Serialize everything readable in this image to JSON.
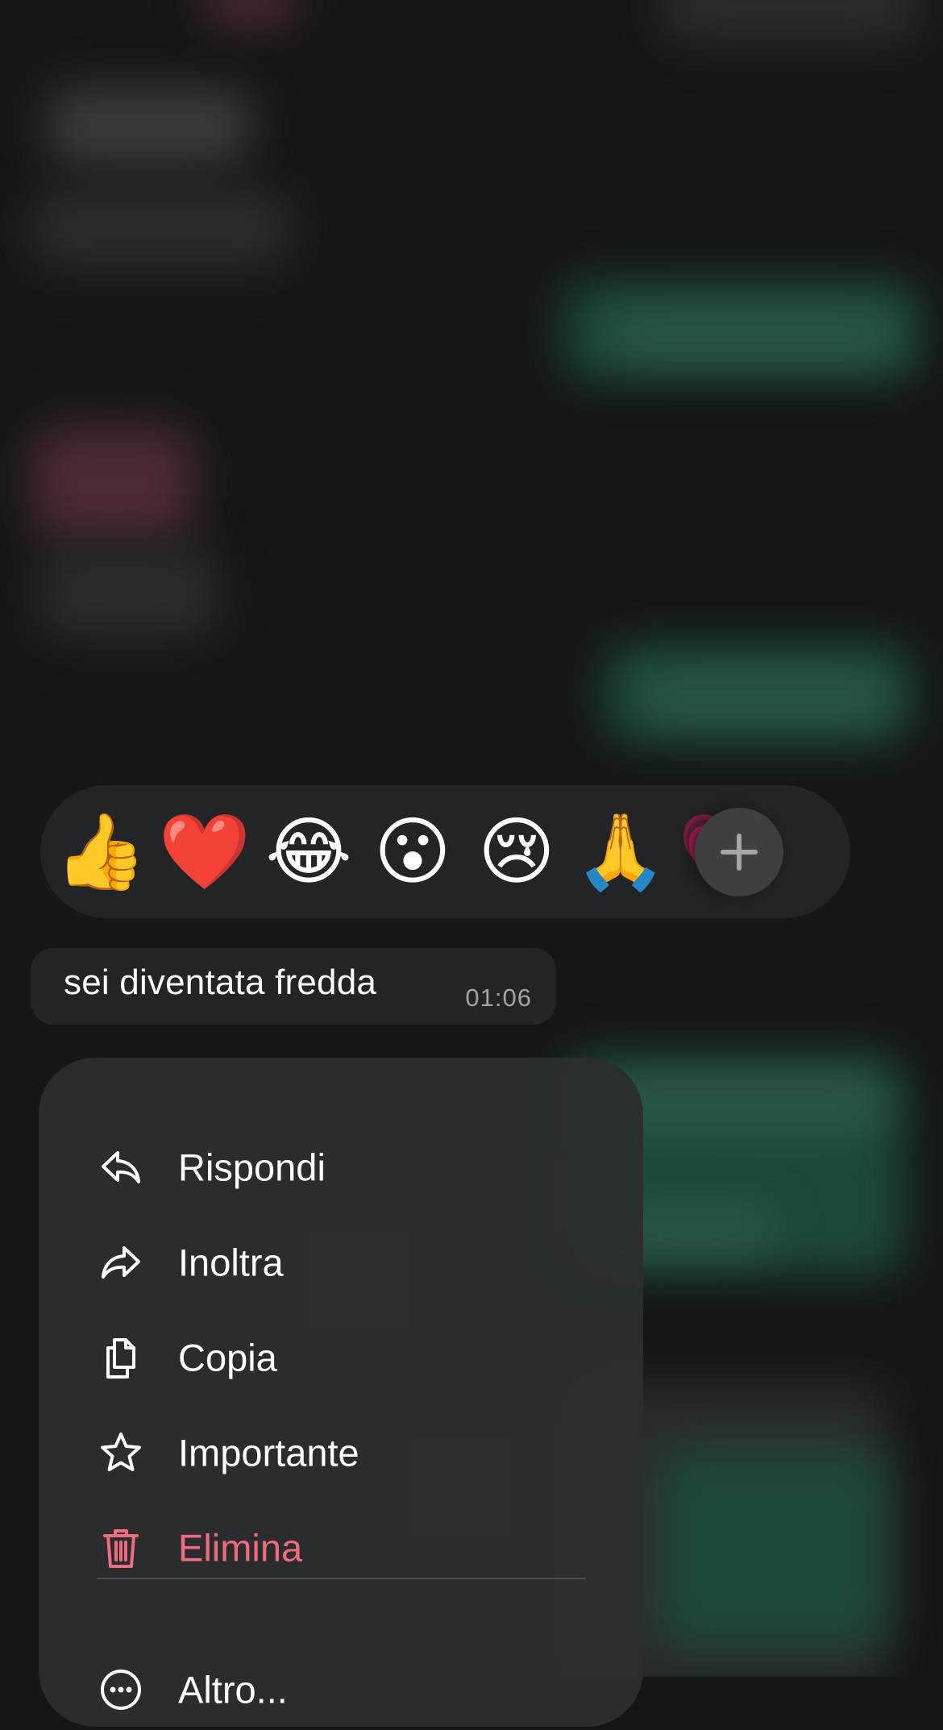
{
  "reactions": {
    "emojis": [
      "👍",
      "❤️",
      "😂",
      "😮",
      "😢",
      "🙏",
      "💗"
    ],
    "more_icon": "plus-icon"
  },
  "message": {
    "text": "sei diventata fredda",
    "time": "01:06"
  },
  "menu": {
    "items": [
      {
        "label": "Rispondi",
        "icon": "reply-icon"
      },
      {
        "label": "Inoltra",
        "icon": "forward-icon"
      },
      {
        "label": "Copia",
        "icon": "copy-icon"
      },
      {
        "label": "Importante",
        "icon": "star-icon"
      },
      {
        "label": "Elimina",
        "icon": "trash-icon"
      },
      {
        "label": "Altro...",
        "icon": "more-icon"
      }
    ]
  },
  "colors": {
    "background": "#161717",
    "surface": "#222425",
    "menu_bg": "#2c2e2f",
    "danger": "#ef6b7d",
    "timestamp": "#a1a5a7"
  }
}
